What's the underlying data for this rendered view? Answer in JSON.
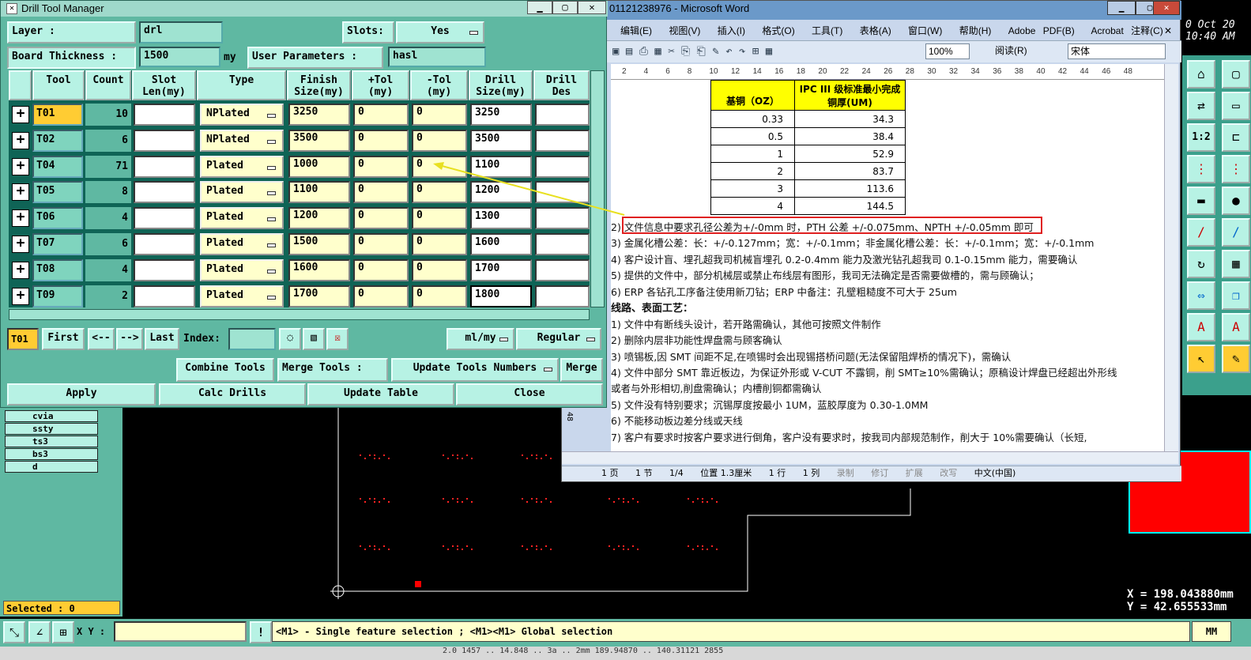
{
  "dtm": {
    "title": "Drill Tool Manager",
    "layer_label": "Layer :",
    "layer_value": "drl",
    "slots_label": "Slots:",
    "slots_value": "Yes",
    "thickness_label": "Board Thickness :",
    "thickness_value": "1500",
    "thickness_unit": "my",
    "user_params_label": "User Parameters :",
    "user_params_value": "hasl",
    "columns": [
      "Tool",
      "Count",
      "Slot\nLen(my)",
      "Type",
      "Finish\nSize(my)",
      "+Tol\n(my)",
      "-Tol\n(my)",
      "Drill\nSize(my)",
      "Drill\nDes"
    ],
    "rows": [
      {
        "tool": "T01",
        "count": "10",
        "type": "NPlated",
        "finish": "3250",
        "ptol": "0",
        "ntol": "0",
        "drill": "3250"
      },
      {
        "tool": "T02",
        "count": "6",
        "type": "NPlated",
        "finish": "3500",
        "ptol": "0",
        "ntol": "0",
        "drill": "3500"
      },
      {
        "tool": "T04",
        "count": "71",
        "type": "Plated",
        "finish": "1000",
        "ptol": "0",
        "ntol": "0",
        "drill": "1100"
      },
      {
        "tool": "T05",
        "count": "8",
        "type": "Plated",
        "finish": "1100",
        "ptol": "0",
        "ntol": "0",
        "drill": "1200"
      },
      {
        "tool": "T06",
        "count": "4",
        "type": "Plated",
        "finish": "1200",
        "ptol": "0",
        "ntol": "0",
        "drill": "1300"
      },
      {
        "tool": "T07",
        "count": "6",
        "type": "Plated",
        "finish": "1500",
        "ptol": "0",
        "ntol": "0",
        "drill": "1600"
      },
      {
        "tool": "T08",
        "count": "4",
        "type": "Plated",
        "finish": "1600",
        "ptol": "0",
        "ntol": "0",
        "drill": "1700"
      },
      {
        "tool": "T09",
        "count": "2",
        "type": "Plated",
        "finish": "1700",
        "ptol": "0",
        "ntol": "0",
        "drill": "1800"
      }
    ],
    "current_tool": "T01",
    "nav": {
      "first": "First",
      "prev": "<--",
      "next": "-->",
      "last": "Last",
      "index_label": "Index:"
    },
    "units": "ml/my",
    "mode": "Regular",
    "combine_tools": "Combine Tools",
    "merge_tools": "Merge Tools :",
    "update_numbers": "Update Tools Numbers",
    "merge": "Merge",
    "apply": "Apply",
    "calc": "Calc Drills",
    "update_table": "Update Table",
    "close": "Close"
  },
  "word": {
    "title": "01121238976 - Microsoft Word",
    "menu": [
      "编辑(E)",
      "视图(V)",
      "插入(I)",
      "格式(O)",
      "工具(T)",
      "表格(A)",
      "窗口(W)",
      "帮助(H)",
      "Adobe PDF(B)",
      "Acrobat 注释(C)"
    ],
    "zoom": "100%",
    "read_button": "阅读(R)",
    "font": "宋体",
    "ruler_ticks": [
      "2",
      "4",
      "6",
      "8",
      "10",
      "12",
      "14",
      "16",
      "18",
      "20",
      "22",
      "24",
      "26",
      "28",
      "30",
      "32",
      "34",
      "36",
      "38",
      "40",
      "42",
      "44",
      "46",
      "48"
    ],
    "table_header": [
      "基铜（OZ）",
      "IPC III 级标准最小完成铜厚(UM)"
    ],
    "table_rows": [
      [
        "0.33",
        "34.3"
      ],
      [
        "0.5",
        "38.4"
      ],
      [
        "1",
        "52.9"
      ],
      [
        "2",
        "83.7"
      ],
      [
        "3",
        "113.6"
      ],
      [
        "4",
        "144.5"
      ]
    ],
    "lines": [
      "2)  文件信息中要求孔径公差为+/-0mm 时，PTH 公差 +/-0.075mm、NPTH +/-0.05mm 即可",
      "3)  金属化槽公差：长：+/-0.127mm；宽：+/-0.1mm；非金属化槽公差：长：+/-0.1mm；宽：+/-0.1mm",
      "4)  客户设计盲、埋孔超我司机械盲埋孔 0.2-0.4mm 能力及激光钻孔超我司 0.1-0.15mm 能力，需要确认",
      "5)  提供的文件中，部分机械层或禁止布线层有图形，我司无法确定是否需要做槽的，需与顾确认；",
      "6)  ERP 各钻孔工序备注使用新刀钻；ERP 中备注：孔壁粗糙度不可大于 25um",
      "线路、表面工艺：",
      "1)  文件中有断线头设计，若开路需确认，其他可按照文件制作",
      "2)  删除内层非功能性焊盘需与顾客确认",
      "3)  喷锡板,因 SMT 间距不足,在喷锡时会出现锡搭桥问题(无法保留阻焊桥的情况下)，需确认",
      "4)  文件中部分 SMT 靠近板边，为保证外形或 V-CUT 不露铜，削 SMT≥10%需确认；原稿设计焊盘已经超出外形线",
      "     或者与外形相切,削盘需确认；内槽削铜都需确认",
      "5)  文件没有特别要求；沉锡厚度按最小 1UM，蓝胶厚度为 0.30-1.0MM",
      "6)  不能移动板边差分线或天线",
      "7)  客户有要求时按客户要求进行倒角，客户没有要求时，按我司内部规范制作，削大于 10%需要确认（长短,"
    ],
    "status": [
      "1 页",
      "1 节",
      "1/4",
      "位置 1.3厘米",
      "1 行",
      "1 列",
      "录制",
      "修订",
      "扩展",
      "改写",
      "中文(中国)"
    ],
    "left_ruler": "48"
  },
  "cam": {
    "layers": [
      "cvia",
      "ssty",
      "ts3",
      "bs3",
      "d"
    ],
    "selected": "Selected : 0",
    "xy_label": "X Y :",
    "hint": "<M1> - Single feature selection ; <M1><M1> Global selection",
    "units_btn": "MM",
    "coord_x": "X = 198.043880mm",
    "coord_y": "Y = 42.655533mm",
    "clock_line1": "0 Oct 20",
    "clock_line2": "10:40 AM",
    "bottom_text": "2.0  1457  ..  14.848  ..  3a  ..  2mm  189.94870  ..  140.31121  2855",
    "right_tools": [
      "1:2"
    ]
  },
  "colors": {
    "cam_teal": "#5fb8a2",
    "highlight": "#ffcc33",
    "red_box": "#e02020",
    "yellow_cell": "#ffff00"
  }
}
